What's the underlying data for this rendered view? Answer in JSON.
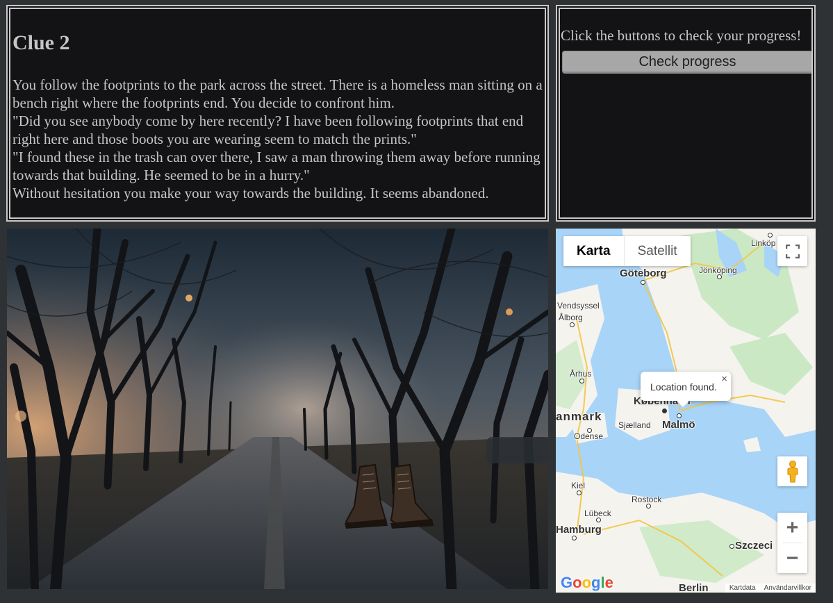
{
  "clue": {
    "title": "Clue 2",
    "paragraphs": [
      "You follow the footprints to the park across the street. There is a homeless man sitting on a bench right where the footprints end. You decide to confront him.",
      "\"Did you see anybody come by here recently? I have been following footprints that end right here and those boots you are wearing seem to match the prints.\"",
      "\"I found these in the trash can over there, I saw a man throwing them away before running towards that building. He seemed to be in a hurry.\"",
      "Without hesitation you make your way towards the building. It seems abandoned."
    ]
  },
  "progress": {
    "hint": "Click the buttons to check your progress!",
    "button_label": "Check progress"
  },
  "map": {
    "map_type_active": "Karta",
    "map_type_inactive": "Satellit",
    "info_text": "Location found.",
    "info_close": "×",
    "footer_data": "Kartdata",
    "footer_terms": "Användarvillkor",
    "logo_letters": [
      "G",
      "o",
      "o",
      "g",
      "l",
      "e"
    ],
    "logo_colors": [
      "#4285F4",
      "#EA4335",
      "#FBBC05",
      "#4285F4",
      "#34A853",
      "#EA4335"
    ],
    "zoom_in": "+",
    "zoom_out": "−",
    "labels": {
      "linkoping": "Linköp",
      "goteborg": "Göteborg",
      "jonkoping": "Jönköping",
      "vendsyssel": "Vendsyssel",
      "alborg": "Ålborg",
      "arhus": "Århus",
      "kobenhavn": "København",
      "danmark": "anmark",
      "sjaelland": "Sjælland",
      "malmo": "Malmö",
      "odense": "Odense",
      "kiel": "Kiel",
      "rostock": "Rostock",
      "lubeck": "Lübeck",
      "hamburg": "Hamburg",
      "szczecin": "Szczeci",
      "berlin": "Berlin"
    }
  },
  "colors": {
    "page_bg": "#2f3234",
    "panel_bg": "#131315",
    "panel_text": "#c6c6c6",
    "button_bg": "#a7a7a7",
    "water": "#a8d4f8",
    "land": "#f5f3ee",
    "forest": "#c7e7c0"
  }
}
